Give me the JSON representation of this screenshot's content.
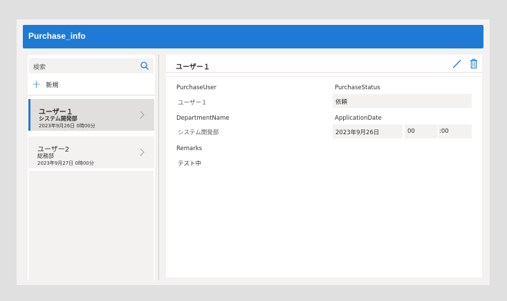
{
  "header": {
    "title": "Purchase_info"
  },
  "search": {
    "placeholder": "検索"
  },
  "new_button": {
    "label": "新規"
  },
  "list": {
    "items": [
      {
        "name": "ユーザー１",
        "department": "システム開発部",
        "date": "2023年9月26日 0時00分",
        "selected": true
      },
      {
        "name": "ユーザー2",
        "department": "総務部",
        "date": "2023年9月27日 0時00分",
        "selected": false
      }
    ]
  },
  "detail": {
    "title": "ユーザー１",
    "purchase_user": {
      "label": "PurchaseUser",
      "value": "ユーザー１"
    },
    "purchase_status": {
      "label": "PurchaseStatus",
      "value": "依頼"
    },
    "department_name": {
      "label": "DepartmentName",
      "value": "システム開発部"
    },
    "application_date": {
      "label": "ApplicationDate",
      "date": "2023年9月26日",
      "hour": "00",
      "minute": ":00"
    },
    "remarks": {
      "label": "Remarks",
      "value": "テスト中"
    }
  },
  "colors": {
    "accent": "#1f7ad6",
    "background": "#e0e0e0",
    "panel": "#f3f2f1"
  }
}
